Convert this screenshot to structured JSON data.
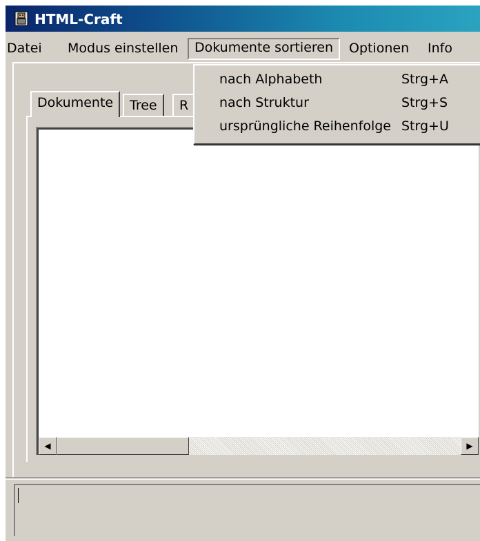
{
  "window": {
    "title": "HTML-Craft",
    "icon": "app-icon"
  },
  "menubar": {
    "items": [
      {
        "label": "Datei"
      },
      {
        "label": "Modus einstellen"
      },
      {
        "label": "Dokumente sortieren"
      },
      {
        "label": "Optionen"
      },
      {
        "label": "Info"
      }
    ],
    "open_menu": "Dokumente sortieren"
  },
  "dropdown": {
    "items": [
      {
        "label": "nach Alphabeth",
        "shortcut": "Strg+A"
      },
      {
        "label": "nach Struktur",
        "shortcut": "Strg+S"
      },
      {
        "label": "ursprüngliche Reihenfolge",
        "shortcut": "Strg+U"
      }
    ]
  },
  "tabs": [
    {
      "label": "Dokumente",
      "active": true
    },
    {
      "label": "Tree",
      "active": false
    },
    {
      "label": "R",
      "active": false
    }
  ],
  "colors": {
    "titlebar_start": "#0a246a",
    "titlebar_end": "#2aa3c0",
    "face": "#d4d0c8"
  }
}
